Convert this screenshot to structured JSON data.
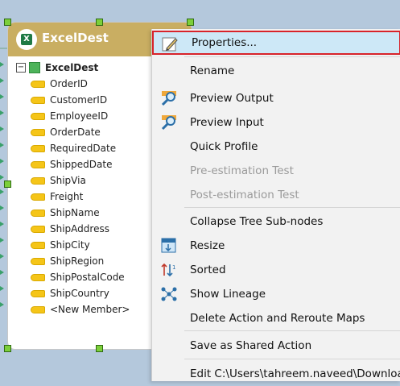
{
  "component": {
    "title": "ExcelDest",
    "logo_text": "X",
    "root_label": "ExcelDest",
    "expander_symbol": "−",
    "fields": [
      "OrderID",
      "CustomerID",
      "EmployeeID",
      "OrderDate",
      "RequiredDate",
      "ShippedDate",
      "ShipVia",
      "Freight",
      "ShipName",
      "ShipAddress",
      "ShipCity",
      "ShipRegion",
      "ShipPostalCode",
      "ShipCountry",
      "<New Member>"
    ]
  },
  "context_menu": {
    "items": [
      {
        "label": "Properties...",
        "icon": "pencil-icon",
        "enabled": true,
        "highlighted": true
      },
      {
        "label": "Rename",
        "icon": "",
        "enabled": true
      },
      {
        "label": "Preview Output",
        "icon": "magnifier-icon",
        "enabled": true
      },
      {
        "label": "Preview Input",
        "icon": "magnifier-icon",
        "enabled": true
      },
      {
        "label": "Quick Profile",
        "icon": "",
        "enabled": true
      },
      {
        "label": "Pre-estimation Test",
        "icon": "",
        "enabled": false
      },
      {
        "label": "Post-estimation Test",
        "icon": "",
        "enabled": false
      },
      {
        "label": "Collapse Tree Sub-nodes",
        "icon": "",
        "enabled": true
      },
      {
        "label": "Resize",
        "icon": "resize-icon",
        "enabled": true
      },
      {
        "label": "Sorted",
        "icon": "sort-icon",
        "enabled": true
      },
      {
        "label": "Show Lineage",
        "icon": "lineage-icon",
        "enabled": true
      },
      {
        "label": "Delete Action and Reroute Maps",
        "icon": "",
        "enabled": true
      },
      {
        "label": "Save as Shared Action",
        "icon": "",
        "enabled": true
      },
      {
        "label": "Edit C:\\Users\\tahreem.naveed\\Downloa",
        "icon": "",
        "enabled": true
      }
    ]
  },
  "colors": {
    "canvas": "#b4c8dc",
    "header": "#c9ae62",
    "highlight_fill": "#cde8f7",
    "highlight_border": "#d8232a"
  }
}
